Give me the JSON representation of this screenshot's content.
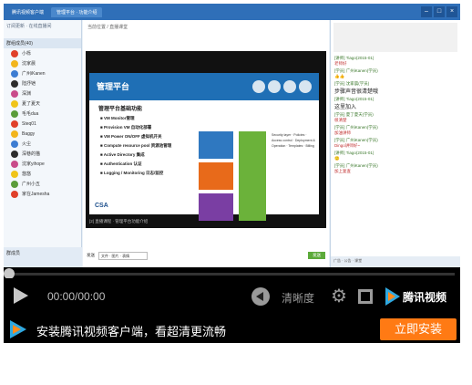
{
  "screen": {
    "titlebar": {
      "tabs": [
        "腾讯视频客户端",
        "管理平台 · 功能介绍"
      ]
    },
    "left_panel": {
      "toplink": "订阅更新 · 在线直播间",
      "section": "群组成员(40)",
      "members": [
        "小栎",
        "沈家晨",
        "广州iKanen",
        "陆抒铠",
        "深渊",
        "夏了夏天",
        "毛毛dua",
        "Steq01",
        "Baggy",
        "火尘",
        "深巷的猫",
        "沈家yihope",
        "悠悠",
        "广州小五",
        "家在Jamesha"
      ],
      "footer": "群成员"
    },
    "middle_panel": {
      "crumb": "当前位置 / 直播课堂",
      "slide": {
        "header": "管理平台",
        "title": "管理平台基础功能",
        "bullets": [
          "VM Monitor管理",
          "Provision VM 自动化部署",
          "VM Power ON/OFF 虚拟机开关",
          "Compute resource pool 资源池管理",
          "Active Directory 集成",
          "Authentication 认证",
          "Logging / Monitoring 日志/监控"
        ],
        "notes": "Security layer · Policies · Access control · Deployment & Operation · Templates · Billing",
        "logo": "CSA"
      },
      "caption": "[2] 直播课程 · 管理平台功能介绍",
      "input": {
        "label": "发送",
        "field": "文件 · 图片 · 表情",
        "send": "发送"
      }
    },
    "right_panel": {
      "messages": [
        {
          "who": "[讲师] Tiago(2015-01)",
          "text": "老师好",
          "dark": false
        },
        {
          "who": "[学员] 广州iKanen(学员)",
          "text": "👍👍",
          "dark": false
        },
        {
          "who": "[学员] 沈家晨(学员)",
          "text": "步骤声音很清楚哦",
          "dark": true
        },
        {
          "who": "[讲师] Tiago(2015-01)",
          "text": "这里加入",
          "dark": true
        },
        {
          "who": "[学员] 夏了夏天(学员)",
          "text": "很清楚",
          "dark": false
        },
        {
          "who": "[学员] 广州iKanen(学员)",
          "text": "加油讲师",
          "dark": false
        },
        {
          "who": "[学员] 广州iKanen(学员)",
          "text": "Dingo讲师好~",
          "dark": false
        },
        {
          "who": "[讲师] Tiago(2015-01)",
          "text": "🙂",
          "dark": false
        },
        {
          "who": "[学员] 广州iKanen(学员)",
          "text": "加上复查",
          "dark": false
        }
      ],
      "bottombar": "广告 · 公告 · 课堂"
    }
  },
  "player": {
    "time": "00:00/00:00",
    "quality": "清晰度",
    "brand": "腾讯视频",
    "promo_text": "安装腾讯视频客户端，看超清更流畅",
    "install_button": "立即安装",
    "progress": 0
  },
  "colors": {
    "accent": "#ff7a14",
    "brand_blue": "#2fa8e0",
    "title_blue": "#2f6fb8"
  }
}
